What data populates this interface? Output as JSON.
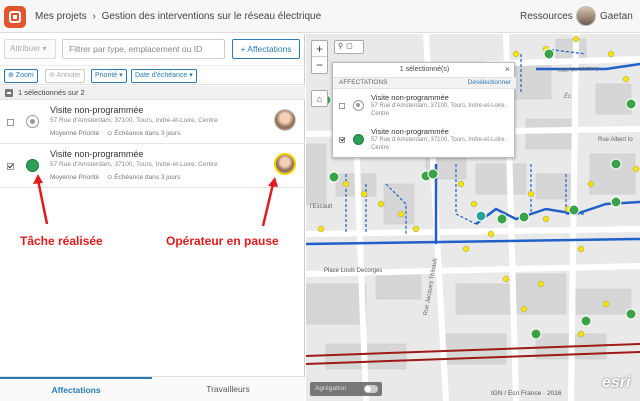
{
  "header": {
    "breadcrumb_root": "Mes projets",
    "breadcrumb_sep": "›",
    "breadcrumb_current": "Gestion des interventions sur le réseau électrique",
    "resources_label": "Ressources",
    "user_name": "Gaetan"
  },
  "toolbar": {
    "assign_label": "Attribuer ▾",
    "filter_placeholder": "Filtrer par type, emplacement ou ID",
    "add_assignment_label": "+ Affectations",
    "zoom_label": "⊕ Zoom",
    "cancel_label": "⊘ Annuler",
    "priority_label": "Priorité ▾",
    "due_date_label": "Date d'échéance ▾"
  },
  "selection": {
    "summary": "1 sélectionnés sur 2"
  },
  "tasks": [
    {
      "title": "Visite non-programmée",
      "address": "57 Rue d'Amsterdam, 37100, Tours, Indre-et-Loire, Centre",
      "priority": "Moyenne Priorité",
      "due": "⊙ Échéance dans 3 jours",
      "status": "pending",
      "checked": false
    },
    {
      "title": "Visite non-programmée",
      "address": "57 Rue d'Amsterdam, 37100, Tours, Indre-et-Loire, Centre",
      "priority": "Moyenne Priorité",
      "due": "⊙ Échéance dans 3 jours",
      "status": "done",
      "checked": true
    }
  ],
  "annotations": {
    "task_done": "Tâche réalisée",
    "operator_paused": "Opérateur en pause"
  },
  "bottom_tabs": {
    "assignments": "Affectations",
    "workers": "Travailleurs"
  },
  "map": {
    "zoom_in": "+",
    "zoom_out": "−",
    "home": "⌂",
    "tools": "⚲▢",
    "popup": {
      "header": "1 sélectionné(s)",
      "close": "×",
      "section_label": "AFFECTATIONS",
      "deselect_label": "Désélectionner",
      "items": [
        {
          "title": "Visite non-programmée",
          "address": "57 Rue d'Amsterdam, 37100, Tours, Indre-et-Loire, Centre"
        },
        {
          "title": "Visite non-programmée",
          "address": "57 Rue d'Amsterdam, 37100, Tours, Indre-et-Loire, Centre"
        }
      ]
    },
    "labels": {
      "rue": "Rue de Mettray",
      "ec": "Éc.",
      "escault": "l'Escault",
      "albert": "Rue Albert Io",
      "place": "Place Louis Decorges",
      "rue2": "Rue Jacques Thibault"
    },
    "aggregation_label": "Agrégation",
    "attribution": "IGN / Esri France · 2016",
    "esri_logo": "esri"
  },
  "colors": {
    "accent": "#2a7ab5",
    "done": "#2f9e5a",
    "paused": "#f0d200",
    "annotation": "#e01b1b",
    "logo": "#e0542e"
  }
}
